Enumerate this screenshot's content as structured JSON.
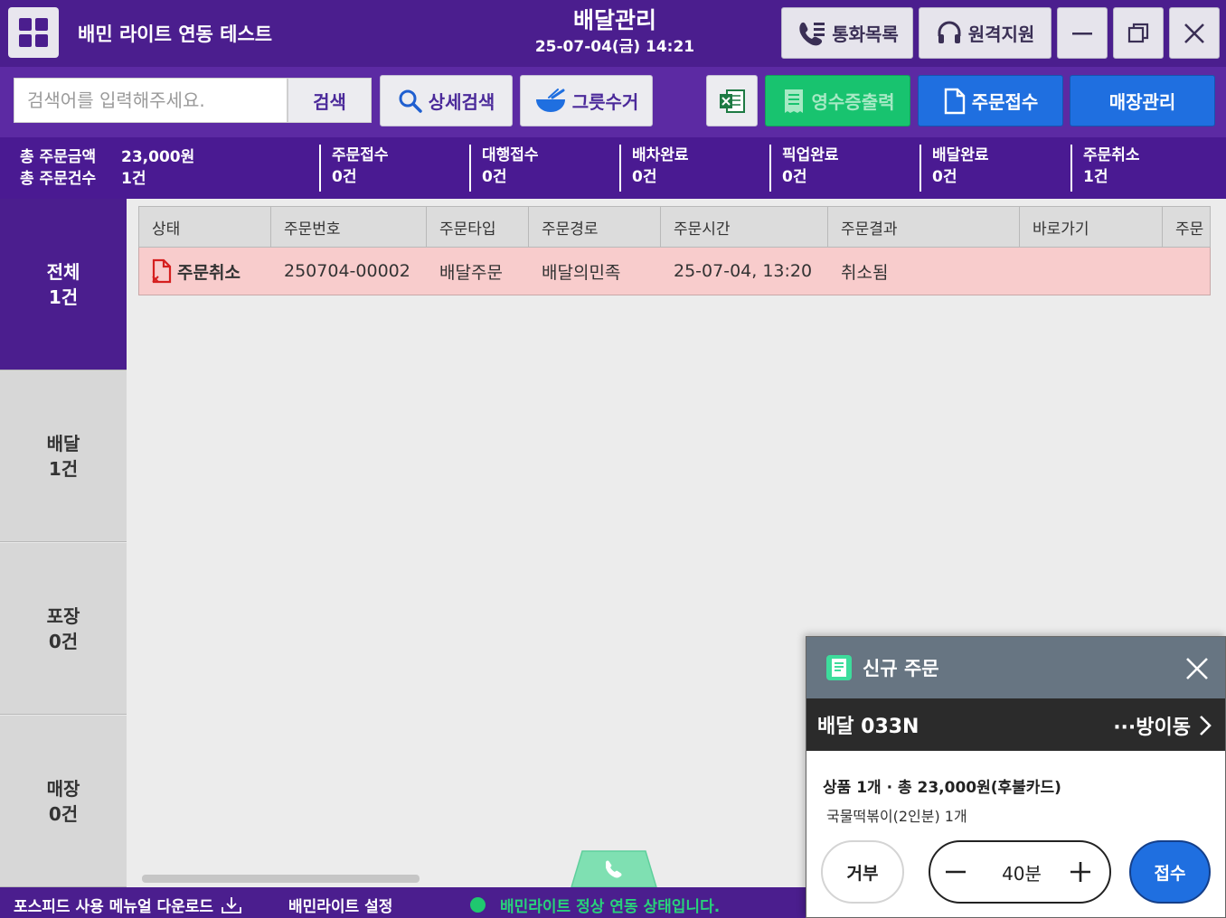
{
  "titlebar": {
    "store_name": "배민 라이트 연동 테스트",
    "title": "배달관리",
    "datetime": "25-07-04(금) 14:21",
    "call_log_label": "통화목록",
    "remote_support_label": "원격지원"
  },
  "toolbar": {
    "search_placeholder": "검색어를 입력해주세요.",
    "search_label": "검색",
    "detail_search_label": "상세검색",
    "dish_collect_label": "그릇수거",
    "receipt_print_label": "영수증출력",
    "order_accept_label": "주문접수",
    "store_manage_label": "매장관리"
  },
  "summary": {
    "total_amount_label": "총 주문금액",
    "total_amount": "23,000원",
    "total_count_label": "총 주문건수",
    "total_count": "1건",
    "stats": [
      {
        "label": "주문접수",
        "value": "0건"
      },
      {
        "label": "대행접수",
        "value": "0건"
      },
      {
        "label": "배차완료",
        "value": "0건"
      },
      {
        "label": "픽업완료",
        "value": "0건"
      },
      {
        "label": "배달완료",
        "value": "0건"
      },
      {
        "label": "주문취소",
        "value": "1건"
      }
    ]
  },
  "nav": [
    {
      "label": "전체",
      "count": "1건"
    },
    {
      "label": "배달",
      "count": "1건"
    },
    {
      "label": "포장",
      "count": "0건"
    },
    {
      "label": "매장",
      "count": "0건"
    }
  ],
  "table": {
    "columns": [
      "상태",
      "주문번호",
      "주문타입",
      "주문경로",
      "주문시간",
      "주문결과",
      "바로가기",
      "주문"
    ],
    "rows": [
      {
        "status": "주문취소",
        "order_no": "250704-00002",
        "type": "배달주문",
        "channel": "배달의민족",
        "time": "25-07-04, 13:20",
        "result": "취소됨",
        "shortcut": "",
        "extra": ""
      }
    ]
  },
  "statusbar": {
    "manual_download": "포스피드 사용 메뉴얼 다운로드",
    "baemin_settings": "배민라이트 설정",
    "link_status": "배민라이트 정상 연동 상태입니다."
  },
  "popup": {
    "title": "신규 주문",
    "order_code": "배달 033N",
    "address": "···방이동",
    "summary_line": "상품 1개 · 총 23,000원(후불카드)",
    "item_line": "국물떡볶이(2인분) 1개",
    "reject_label": "거부",
    "time_value": "40분",
    "accept_label": "접수"
  },
  "colors": {
    "primary_purple": "#4b1e8e",
    "toolbar_purple": "#5c2aa3",
    "receipt_green": "#18c36f",
    "accent_blue": "#1f6fe0",
    "cancel_red": "#d51f1f",
    "cancel_row_bg": "#f8cccc",
    "status_green": "#1fc86f"
  },
  "icons": {
    "app_menu": "grid-icon",
    "call_log": "phone-list-icon",
    "remote_support": "headset-icon",
    "minimize": "minimize-icon",
    "restore": "restore-icon",
    "close": "close-icon",
    "detail_search": "search-icon",
    "dish_collect": "bowl-icon",
    "excel": "excel-icon",
    "receipt": "receipt-icon",
    "order_accept": "document-icon",
    "cancel_status": "document-cancel-icon",
    "download": "download-icon",
    "popup": "order-book-icon"
  }
}
